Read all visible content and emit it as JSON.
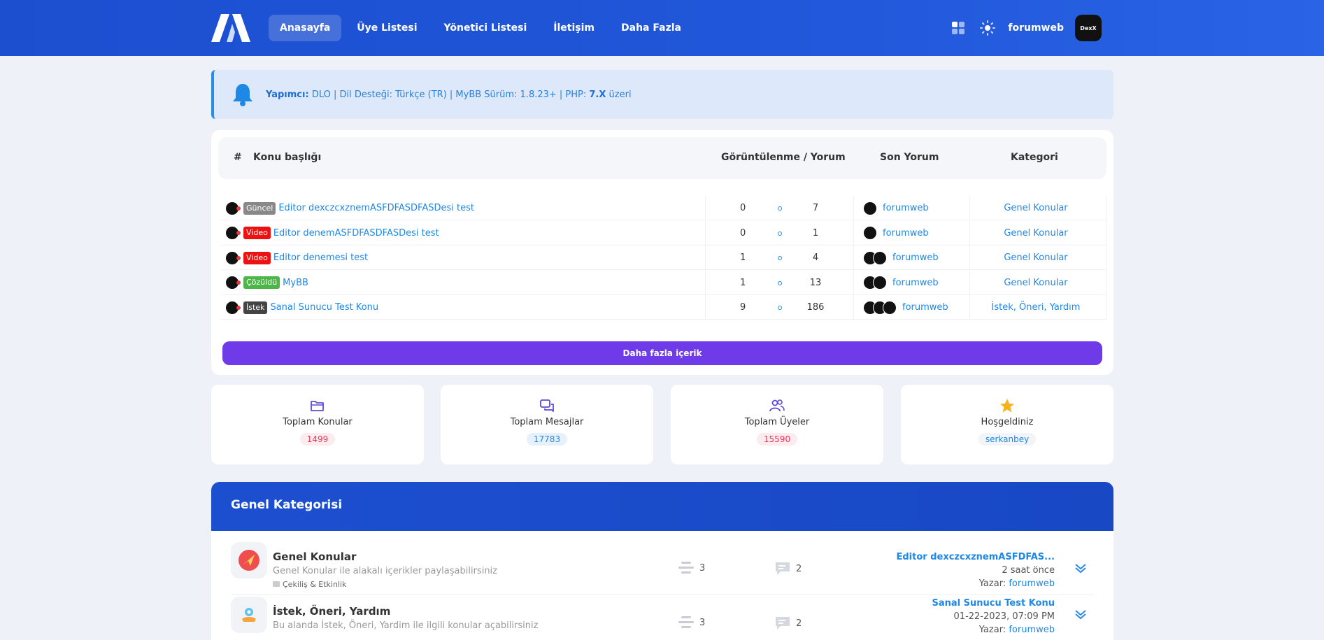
{
  "nav": {
    "items": [
      "Anasayfa",
      "Üye Listesi",
      "Yönetici Listesi",
      "İletişim",
      "Daha Fazla"
    ],
    "user": "forumweb",
    "avatar_text": "DexX"
  },
  "notice": {
    "label": "Yapımcı:",
    "text_a": "DLO | Dil Desteği: Türkçe (TR) | MyBB Sürüm: 1.8.23+ | PHP: ",
    "php": "7.X",
    "text_b": " üzeri"
  },
  "topics": {
    "headers": {
      "hash": "#",
      "title": "Konu başlığı",
      "views": "Görüntülenme / Yorum",
      "last": "Son Yorum",
      "category": "Kategori"
    },
    "rows": [
      {
        "badge": "Güncel",
        "badge_color": "#888888",
        "title": "Editor dexczcxznemASFDFASDFASDesi test",
        "views": "0",
        "replies": "7",
        "last_user": "forumweb",
        "category": "Genel Konular"
      },
      {
        "badge": "Video",
        "badge_color": "#ee1111",
        "title": "Editor denemASFDFASDFASDesi test",
        "views": "0",
        "replies": "1",
        "last_user": "forumweb",
        "category": "Genel Konular"
      },
      {
        "badge": "Video",
        "badge_color": "#ee1111",
        "title": "Editor denemesi test",
        "views": "1",
        "replies": "4",
        "last_user": "forumweb",
        "category": "Genel Konular"
      },
      {
        "badge": "Çözüldü",
        "badge_color": "#4cb648",
        "title": "MyBB",
        "views": "1",
        "replies": "13",
        "last_user": "forumweb",
        "category": "Genel Konular"
      },
      {
        "badge": "İstek",
        "badge_color": "#444444",
        "title": "Sanal Sunucu Test Konu",
        "views": "9",
        "replies": "186",
        "last_user": "forumweb",
        "category": "İstek, Öneri, Yardım"
      }
    ],
    "more_label": "Daha fazla içerik"
  },
  "stats": [
    {
      "label": "Toplam Konular",
      "value": "1499",
      "icon": "folder-icon"
    },
    {
      "label": "Toplam Mesajlar",
      "value": "17783",
      "icon": "messages-icon"
    },
    {
      "label": "Toplam Üyeler",
      "value": "15590",
      "icon": "users-icon"
    },
    {
      "label": "Hoşgeldiniz",
      "value": "serkanbey",
      "icon": "star-icon"
    }
  ],
  "category": {
    "title": "Genel Kategorisi",
    "forums": [
      {
        "name": "Genel Konular",
        "desc": "Genel Konular ile alakalı içerikler paylaşabilirsiniz",
        "sub": "Çekiliş & Etkinlik",
        "threads": "3",
        "posts": "2",
        "last_title": "Editor dexczcxznemASFDFAS...",
        "last_date": "2 saat önce",
        "author_label": "Yazar:",
        "last_author": "forumweb"
      },
      {
        "name": "İstek, Öneri, Yardım",
        "desc": "Bu alanda İstek, Öneri, Yardim ile ilgili konular açabilirsiniz",
        "sub": "",
        "threads": "3",
        "posts": "2",
        "last_title": "Sanal Sunucu Test Konu",
        "last_date": "01-22-2023, 07:09 PM",
        "author_label": "Yazar:",
        "last_author": "forumweb"
      }
    ]
  },
  "colors": {
    "header": "#1c4fd0",
    "accent": "#1e88e5",
    "button": "#6f3be8",
    "pink": "#e8365d"
  }
}
